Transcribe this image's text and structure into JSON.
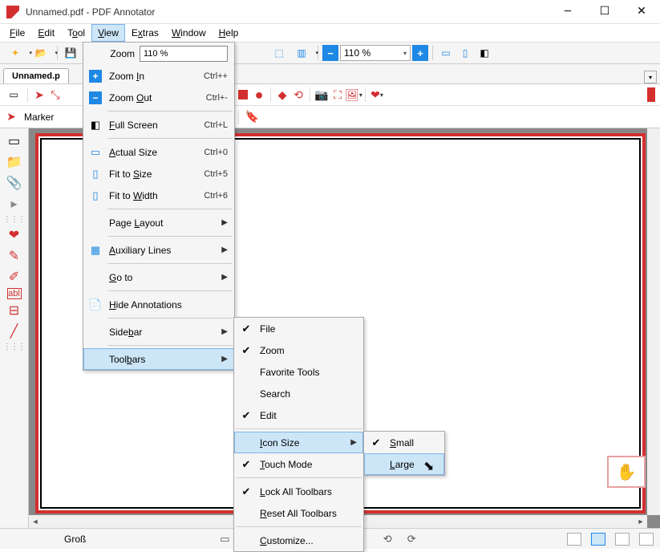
{
  "window": {
    "title": "Unnamed.pdf - PDF Annotator"
  },
  "menubar": {
    "file": "File",
    "edit": "Edit",
    "tool": "Tool",
    "view": "View",
    "extras": "Extras",
    "window": "Window",
    "help": "Help"
  },
  "toolbar": {
    "zoom_value": "110 %"
  },
  "tabs": {
    "current": "Unnamed.p"
  },
  "annbar": {
    "marker_label": "Marker"
  },
  "statusbar": {
    "size_label": "Groß"
  },
  "viewmenu": {
    "zoom_label": "Zoom",
    "zoom_value": "110 %",
    "zoom_in": "Zoom In",
    "zoom_in_sc": "Ctrl++",
    "zoom_out": "Zoom Out",
    "zoom_out_sc": "Ctrl+-",
    "full_screen": "Full Screen",
    "full_screen_sc": "Ctrl+L",
    "actual_size": "Actual Size",
    "actual_size_sc": "Ctrl+0",
    "fit_size": "Fit to Size",
    "fit_size_sc": "Ctrl+5",
    "fit_width": "Fit to Width",
    "fit_width_sc": "Ctrl+6",
    "page_layout": "Page Layout",
    "aux_lines": "Auxiliary Lines",
    "go_to": "Go to",
    "hide_ann": "Hide Annotations",
    "sidebar": "Sidebar",
    "toolbars": "Toolbars"
  },
  "toolbars_sub": {
    "file": "File",
    "zoom": "Zoom",
    "fav": "Favorite Tools",
    "search": "Search",
    "edit": "Edit",
    "icon_size": "Icon Size",
    "touch": "Touch Mode",
    "lock": "Lock All Toolbars",
    "reset": "Reset All Toolbars",
    "custom": "Customize..."
  },
  "iconsize_sub": {
    "small": "Small",
    "large": "Large"
  }
}
